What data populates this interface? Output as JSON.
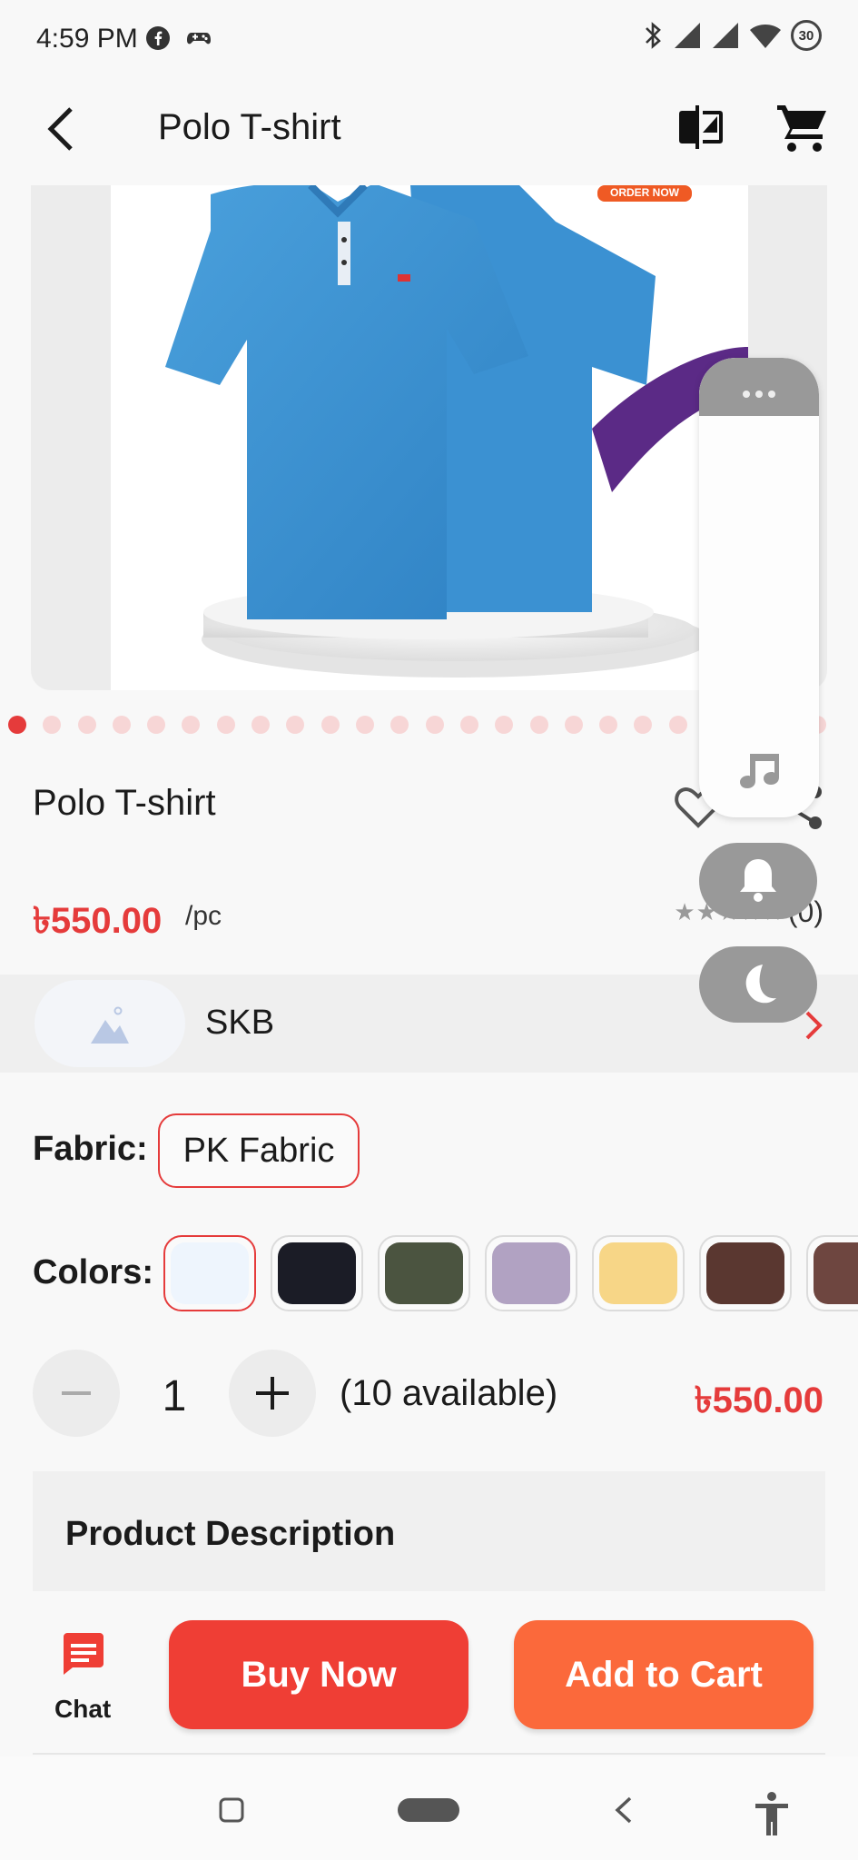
{
  "status_bar": {
    "time": "4:59 PM",
    "icons": [
      "facebook-icon",
      "gamepad-icon",
      "bluetooth-icon",
      "signal-icon",
      "signal-icon",
      "wifi-icon",
      "battery-icon"
    ],
    "battery": "30"
  },
  "app_bar": {
    "title": "Polo T-shirt",
    "icons": [
      "back-arrow-icon",
      "compare-icon",
      "cart-icon"
    ]
  },
  "gallery": {
    "image_count": 24,
    "active_index": 0,
    "banner_text": "ORDER NOW"
  },
  "product": {
    "name": "Polo T-shirt",
    "price": "৳550.00",
    "unit": "/pc",
    "rating_stars": "★★★★★",
    "rating_count": "(0)"
  },
  "seller": {
    "name": "SKB"
  },
  "fabric": {
    "label": "Fabric:",
    "selected": "PK Fabric"
  },
  "colors": {
    "label": "Colors:",
    "swatches": [
      "#eef5fd",
      "#1b1c26",
      "#4b5440",
      "#b1a2c2",
      "#f7d687",
      "#5a3730",
      "#6e4640"
    ],
    "selected_index": 0
  },
  "quantity": {
    "value": "1",
    "available": "(10 available)",
    "total": "৳550.00"
  },
  "description": {
    "title": "Product Description"
  },
  "actions": {
    "chat": "Chat",
    "buy_now": "Buy Now",
    "add_to_cart": "Add to Cart"
  },
  "colors_theme": {
    "accent": "#e53b3b",
    "buy_button": "#ef3e35",
    "cart_button": "#fb693b"
  }
}
